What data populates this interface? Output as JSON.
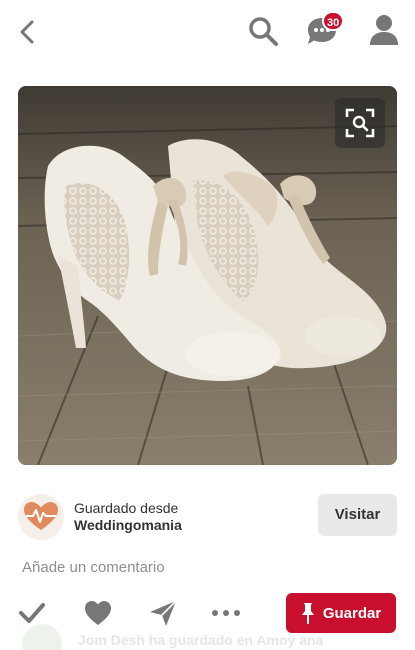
{
  "header": {
    "notification_count": "30",
    "icons": [
      "chevron-left-icon",
      "search-icon",
      "chat-bubble-icon",
      "profile-icon"
    ],
    "accent_color": "#c8102e"
  },
  "pin": {
    "image_alt": "ivory lace t-strap heels with bows on wooden planks",
    "lens_icon": "visual-search-icon"
  },
  "source": {
    "saved_from_label": "Guardado desde",
    "name": "Weddingomania",
    "logo_icon": "heart-pulse-icon",
    "visit_label": "Visitar"
  },
  "comment": {
    "placeholder": "Añade un comentario"
  },
  "actions": {
    "icons": [
      "checkmark-icon",
      "heart-icon",
      "send-icon",
      "more-icon",
      "pushpin-icon"
    ],
    "save_label": "Guardar"
  },
  "activity": {
    "text": "Jom Desh ha guardado en Amoy ana"
  }
}
